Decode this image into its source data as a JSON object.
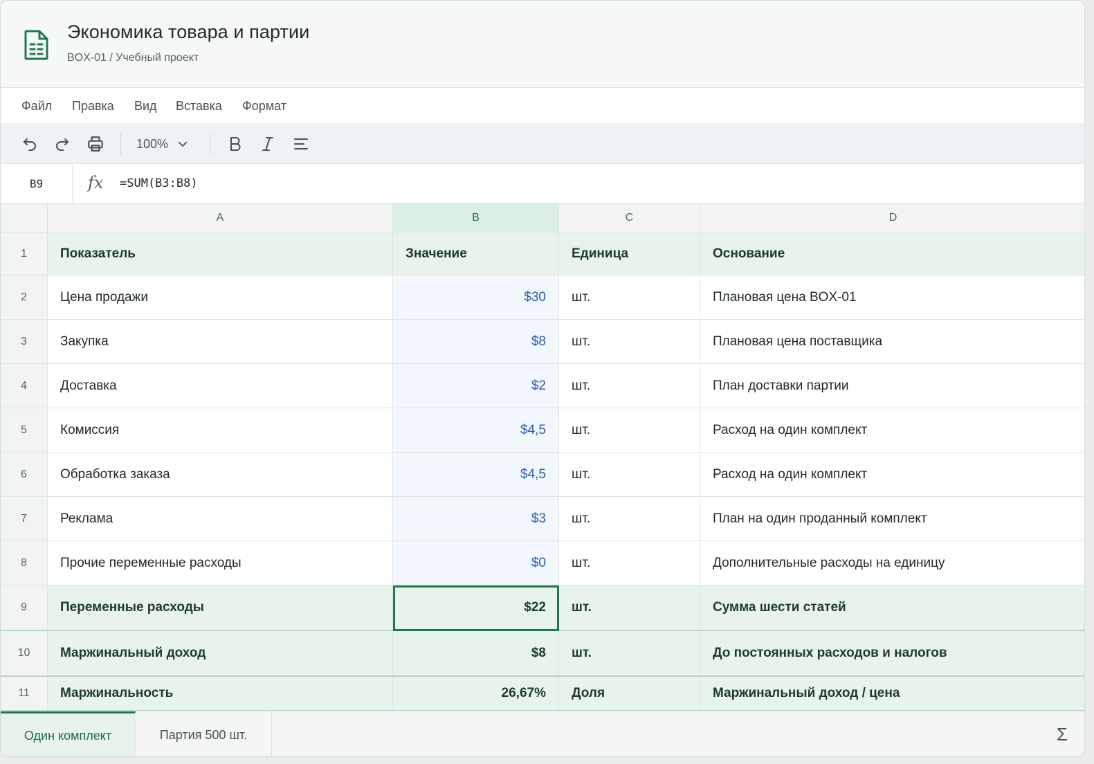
{
  "header": {
    "title": "Экономика товара и партии",
    "subtitle": "BOX-01 / Учебный проект"
  },
  "menu": [
    "Файл",
    "Правка",
    "Вид",
    "Вставка",
    "Формат"
  ],
  "toolbar": {
    "zoom": "100%",
    "icons": [
      "undo-icon",
      "redo-icon",
      "print-icon",
      "bold-icon",
      "italic-icon",
      "align-icon"
    ]
  },
  "formula_bar": {
    "cell_ref": "B9",
    "fx": "fx",
    "formula": "=SUM(B3:B8)"
  },
  "columns": [
    "A",
    "B",
    "C",
    "D"
  ],
  "rows": [
    {
      "num": "1",
      "a": "Показатель",
      "b": "Значение",
      "c": "Единица",
      "d": "Основание"
    },
    {
      "num": "2",
      "a": "Цена продажи",
      "b": "$30",
      "c": "шт.",
      "d": "Плановая цена BOX-01"
    },
    {
      "num": "3",
      "a": "Закупка",
      "b": "$8",
      "c": "шт.",
      "d": "Плановая цена поставщика"
    },
    {
      "num": "4",
      "a": "Доставка",
      "b": "$2",
      "c": "шт.",
      "d": "План доставки партии"
    },
    {
      "num": "5",
      "a": "Комиссия",
      "b": "$4,5",
      "c": "шт.",
      "d": "Расход на один комплект"
    },
    {
      "num": "6",
      "a": "Обработка заказа",
      "b": "$4,5",
      "c": "шт.",
      "d": "Расход на один комплект"
    },
    {
      "num": "7",
      "a": "Реклама",
      "b": "$3",
      "c": "шт.",
      "d": "План на один проданный комплект"
    },
    {
      "num": "8",
      "a": "Прочие переменные расходы",
      "b": "$0",
      "c": "шт.",
      "d": "Дополнительные расходы на единицу"
    },
    {
      "num": "9",
      "a": "Переменные расходы",
      "b": "$22",
      "c": "шт.",
      "d": "Сумма шести статей"
    },
    {
      "num": "10",
      "a": "Маржинальный доход",
      "b": "$8",
      "c": "шт.",
      "d": "До постоянных расходов и налогов"
    },
    {
      "num": "11",
      "a": "Маржинальность",
      "b": "26,67%",
      "c": "Доля",
      "d": "Маржинальный доход / цена"
    }
  ],
  "selected_cell": "B9",
  "sheets": [
    {
      "label": "Один комплект",
      "active": true
    },
    {
      "label": "Партия 500 шт.",
      "active": false
    }
  ],
  "status": {
    "sigma": "Σ"
  },
  "colors": {
    "accent": "#1e7a4c",
    "value_blue": "#2a5db0",
    "highlight_row": "#e7f3eb"
  }
}
